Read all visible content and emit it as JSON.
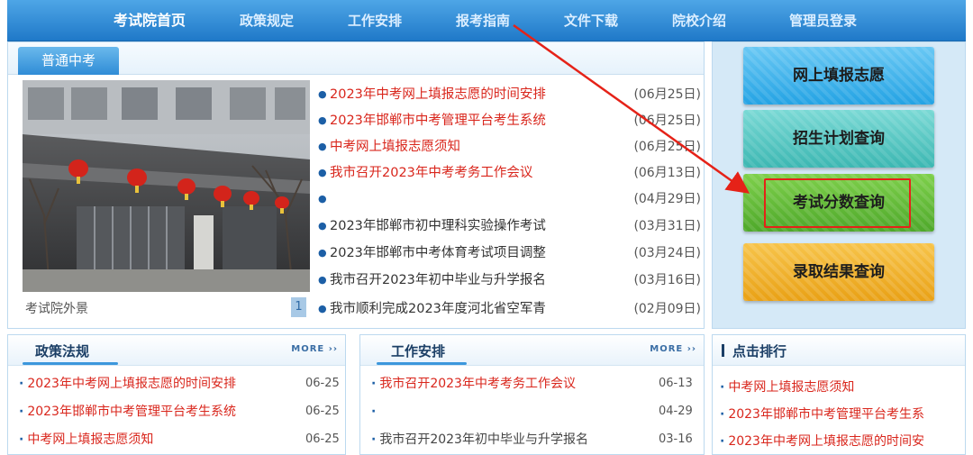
{
  "nav": {
    "items": [
      {
        "label": "考试院首页"
      },
      {
        "label": "政策规定"
      },
      {
        "label": "工作安排"
      },
      {
        "label": "报考指南"
      },
      {
        "label": "文件下载"
      },
      {
        "label": "院校介绍"
      },
      {
        "label": "管理员登录"
      }
    ]
  },
  "main": {
    "tab_label": "普通中考",
    "photo_caption": "考试院外景",
    "page_number": "1",
    "news": [
      {
        "title": "2023年中考网上填报志愿的时间安排",
        "date": "(06月25日)"
      },
      {
        "title": "2023年邯郸市中考管理平台考生系统",
        "date": "(06月25日)"
      },
      {
        "title": "中考网上填报志愿须知",
        "date": "(06月25日)"
      },
      {
        "title": "我市召开2023年中考考务工作会议",
        "date": "(06月13日)"
      },
      {
        "title": "",
        "date": "(04月29日)"
      },
      {
        "title": "2023年邯郸市初中理科实验操作考试",
        "date": "(03月31日)"
      },
      {
        "title": "2023年邯郸市中考体育考试项目调整",
        "date": "(03月24日)"
      },
      {
        "title": "我市召开2023年初中毕业与升学报名",
        "date": "(03月16日)"
      },
      {
        "title": "我市顺利完成2023年度河北省空军青",
        "date": "(02月09日)"
      }
    ]
  },
  "quick_links": [
    {
      "label": "网上填报志愿"
    },
    {
      "label": "招生计划查询"
    },
    {
      "label": "考试分数查询"
    },
    {
      "label": "录取结果查询"
    }
  ],
  "policy": {
    "title": "政策法规",
    "more": "MORE ››",
    "items": [
      {
        "title": "2023年中考网上填报志愿的时间安排",
        "date": "06-25"
      },
      {
        "title": "2023年邯郸市中考管理平台考生系统",
        "date": "06-25"
      },
      {
        "title": "中考网上填报志愿须知",
        "date": "06-25"
      }
    ]
  },
  "work": {
    "title": "工作安排",
    "more": "MORE ››",
    "items": [
      {
        "title": "我市召开2023年中考考务工作会议",
        "date": "06-13"
      },
      {
        "title": "",
        "date": "04-29"
      },
      {
        "title": "我市召开2023年初中毕业与升学报名",
        "date": "03-16"
      }
    ]
  },
  "ranking": {
    "title": "点击排行",
    "items": [
      {
        "title": "中考网上填报志愿须知"
      },
      {
        "title": "2023年邯郸市中考管理平台考生系"
      },
      {
        "title": "2023年中考网上填报志愿的时间安"
      }
    ]
  },
  "colors": {
    "nav": "#2b86d2",
    "link_red": "#d9261c",
    "highlight_red": "#e52218",
    "panel_blue": "#d5e9f7"
  }
}
